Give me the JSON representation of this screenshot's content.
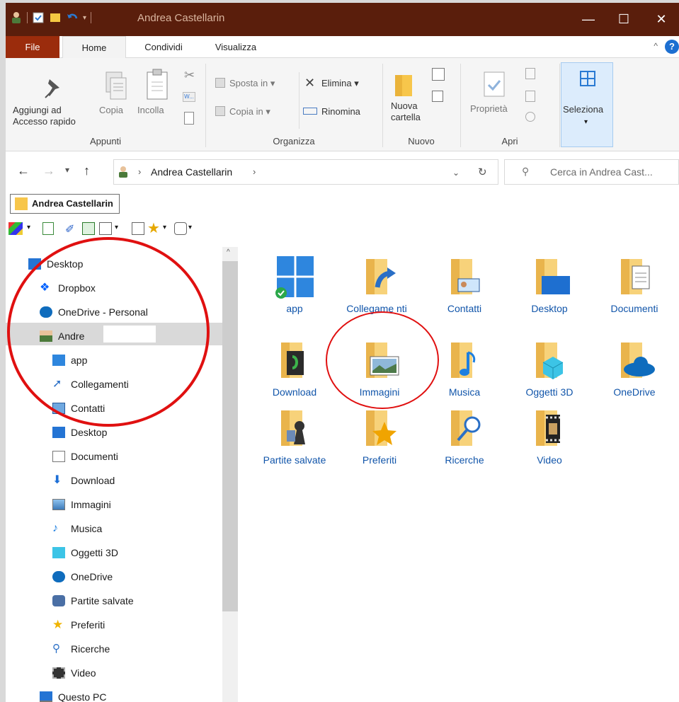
{
  "window": {
    "title": "Andrea Castellarin",
    "controls": {
      "minimize": "—",
      "maximize": "☐",
      "close": "✕"
    }
  },
  "tabs": [
    "File",
    "Home",
    "Condividi",
    "Visualizza"
  ],
  "ribbon": {
    "appunti": {
      "label": "Appunti",
      "pin": [
        "Aggiungi ad",
        "Accesso rapido"
      ],
      "copy": "Copia",
      "paste": "Incolla"
    },
    "organizza": {
      "label": "Organizza",
      "move": "Sposta in",
      "copy_to": "Copia in",
      "delete": "Elimina",
      "rename": "Rinomina"
    },
    "nuovo": {
      "label": "Nuovo",
      "new_folder": [
        "Nuova",
        "cartella"
      ]
    },
    "apri": {
      "label": "Apri",
      "properties": "Proprietà"
    },
    "seleziona": {
      "label": "Seleziona"
    }
  },
  "address": {
    "path": "Andrea Castellarin",
    "search_placeholder": "Cerca in Andrea Cast..."
  },
  "shell_tab": "Andrea Castellarin",
  "navpane": {
    "items": [
      {
        "label": "Desktop",
        "icon": "desktop-icon"
      },
      {
        "label": "Dropbox",
        "icon": "dropbox-icon"
      },
      {
        "label": "OneDrive - Personal",
        "icon": "onedrive-icon"
      },
      {
        "label": "Andre",
        "icon": "user-icon"
      },
      {
        "label": "app",
        "icon": "app-icon"
      },
      {
        "label": "Collegamenti",
        "icon": "links-icon"
      },
      {
        "label": "Contatti",
        "icon": "contacts-icon"
      },
      {
        "label": "Desktop",
        "icon": "desktop-icon"
      },
      {
        "label": "Documenti",
        "icon": "documents-icon"
      },
      {
        "label": "Download",
        "icon": "download-icon"
      },
      {
        "label": "Immagini",
        "icon": "pictures-icon"
      },
      {
        "label": "Musica",
        "icon": "music-icon"
      },
      {
        "label": "Oggetti 3D",
        "icon": "objects3d-icon"
      },
      {
        "label": "OneDrive",
        "icon": "onedrive-icon"
      },
      {
        "label": "Partite salvate",
        "icon": "savedgames-icon"
      },
      {
        "label": "Preferiti",
        "icon": "favorites-icon"
      },
      {
        "label": "Ricerche",
        "icon": "searches-icon"
      },
      {
        "label": "Video",
        "icon": "video-icon"
      },
      {
        "label": "Questo PC",
        "icon": "thispc-icon"
      }
    ]
  },
  "content": {
    "items": [
      {
        "label": "app",
        "icon": "app-icon"
      },
      {
        "label": "Collegame nti",
        "icon": "links-folder-icon"
      },
      {
        "label": "Contatti",
        "icon": "contacts-folder-icon"
      },
      {
        "label": "Desktop",
        "icon": "desktop-folder-icon"
      },
      {
        "label": "Documenti",
        "icon": "documents-folder-icon"
      },
      {
        "label": "Download",
        "icon": "download-folder-icon"
      },
      {
        "label": "Immagini",
        "icon": "pictures-folder-icon"
      },
      {
        "label": "Musica",
        "icon": "music-folder-icon"
      },
      {
        "label": "Oggetti 3D",
        "icon": "objects3d-folder-icon"
      },
      {
        "label": "OneDrive",
        "icon": "onedrive-folder-icon"
      },
      {
        "label": "Partite salvate",
        "icon": "savedgames-folder-icon"
      },
      {
        "label": "Preferiti",
        "icon": "favorites-folder-icon"
      },
      {
        "label": "Ricerche",
        "icon": "searches-folder-icon"
      },
      {
        "label": "Video",
        "icon": "video-folder-icon"
      }
    ]
  },
  "colors": {
    "titlebar": "#5a1e0c",
    "file_tab": "#9b2c0c",
    "annotation": "#e01010",
    "link_text": "#1155aa"
  }
}
